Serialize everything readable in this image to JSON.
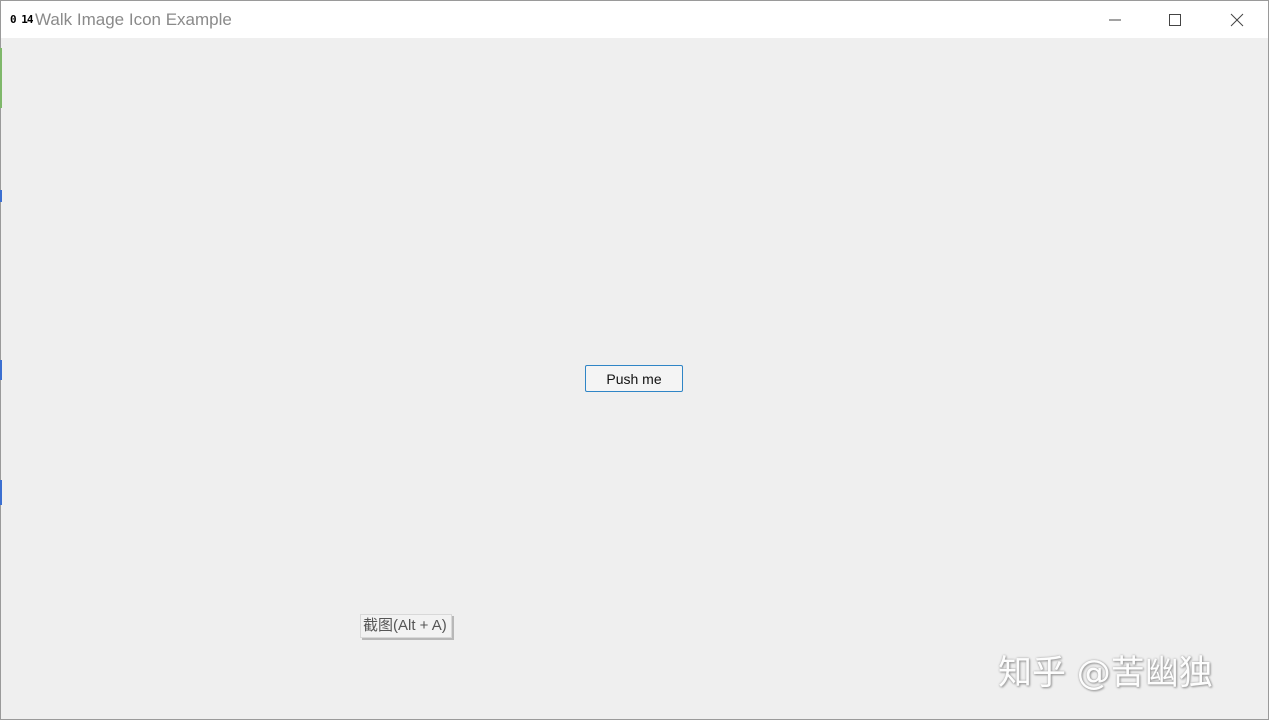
{
  "window": {
    "icon_text": "0 14",
    "title": "Walk Image Icon Example"
  },
  "content": {
    "button_label": "Push me"
  },
  "tooltip": {
    "text": "截图(Alt + A)"
  },
  "watermark": {
    "text": "知乎 @苦幽独"
  },
  "colors": {
    "accent": "#2f85c6",
    "background": "#efefef",
    "titlebar": "#ffffff"
  }
}
